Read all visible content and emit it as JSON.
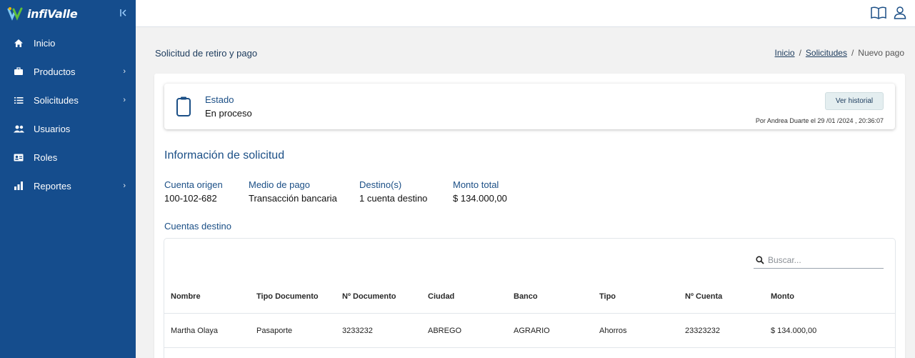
{
  "app": {
    "logo_text": "infiValle",
    "collapse_icon": "collapse-left-icon"
  },
  "colors": {
    "sidebar": "#154d8d",
    "accent": "#1b4f86",
    "background": "#f2f2f2"
  },
  "sidebar": {
    "items": [
      {
        "label": "Inicio",
        "icon": "home-icon",
        "has_submenu": false
      },
      {
        "label": "Productos",
        "icon": "briefcase-icon",
        "has_submenu": true
      },
      {
        "label": "Solicitudes",
        "icon": "list-icon",
        "has_submenu": true
      },
      {
        "label": "Usuarios",
        "icon": "users-icon",
        "has_submenu": false
      },
      {
        "label": "Roles",
        "icon": "id-card-icon",
        "has_submenu": false
      },
      {
        "label": "Reportes",
        "icon": "chart-icon",
        "has_submenu": true
      }
    ]
  },
  "topbar": {
    "icons": [
      "book-icon",
      "user-icon"
    ]
  },
  "page": {
    "title": "Solicitud de retiro y pago",
    "breadcrumb": [
      {
        "label": "Inicio",
        "link": true
      },
      {
        "label": "Solicitudes",
        "link": true
      },
      {
        "label": "Nuevo pago",
        "link": false
      }
    ]
  },
  "status": {
    "label": "Estado",
    "value": "En proceso",
    "history_button": "Ver historial",
    "meta": "Por Andrea Duarte el 29 /01 /2024 , 20:36:07"
  },
  "info": {
    "title": "Información de solicitud",
    "fields": [
      {
        "label": "Cuenta origen",
        "value": "100-102-682"
      },
      {
        "label": "Medio de pago",
        "value": "Transacción bancaria"
      },
      {
        "label": "Destino(s)",
        "value": "1 cuenta destino"
      },
      {
        "label": "Monto total",
        "value": "$ 134.000,00"
      }
    ]
  },
  "destinations": {
    "title": "Cuentas destino",
    "search_placeholder": "Buscar...",
    "columns": [
      "Nombre",
      "Tipo Documento",
      "Nº Documento",
      "Ciudad",
      "Banco",
      "Tipo",
      "Nº Cuenta",
      "Monto"
    ],
    "rows": [
      [
        "Martha Olaya",
        "Pasaporte",
        "3233232",
        "ABREGO",
        "AGRARIO",
        "Ahorros",
        "23323232",
        "$ 134.000,00"
      ]
    ]
  }
}
